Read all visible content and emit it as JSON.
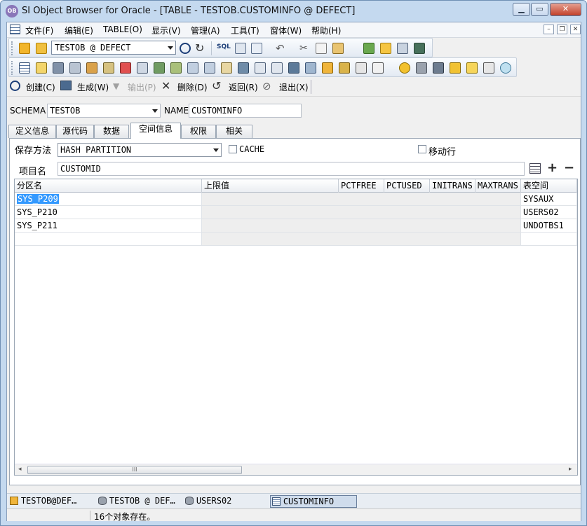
{
  "window": {
    "app_icon_text": "OB",
    "title": "SI Object Browser for Oracle - [TABLE - TESTOB.CUSTOMINFO @ DEFECT]"
  },
  "menu": [
    "文件(F)",
    "编辑(E)",
    "TABLE(O)",
    "显示(V)",
    "管理(A)",
    "工具(T)",
    "窗体(W)",
    "帮助(H)"
  ],
  "toolbar": {
    "connection": "TESTOB @ DEFECT",
    "sql_label": "SQL"
  },
  "actions": {
    "create": "创建(C)",
    "generate": "生成(W)",
    "output": "输出(P)",
    "delete": "删除(D)",
    "back": "返回(R)",
    "exit": "退出(X)"
  },
  "object": {
    "schema_label": "SCHEMA",
    "schema_value": "TESTOB",
    "name_label": "NAME",
    "name_value": "CUSTOMINFO"
  },
  "tabs": [
    "定义信息",
    "源代码",
    "数据",
    "空间信息",
    "权限",
    "相关"
  ],
  "active_tab": "空间信息",
  "space": {
    "storage_label": "保存方法",
    "storage_value": "HASH PARTITION",
    "cache_label": "CACHE",
    "row_movement_label": "移动行",
    "column_label": "项目名",
    "column_value": "CUSTOMID",
    "add_symbol": "+",
    "remove_symbol": "−"
  },
  "grid": {
    "columns": [
      "分区名",
      "上限值",
      "PCTFREE",
      "PCTUSED",
      "INITRANS",
      "MAXTRANS",
      "表空间"
    ],
    "rows": [
      {
        "partition": "SYS_P209",
        "tablespace": "SYSAUX"
      },
      {
        "partition": "SYS_P210",
        "tablespace": "USERS02"
      },
      {
        "partition": "SYS_P211",
        "tablespace": "UNDOTBS1"
      }
    ],
    "scroll_thumb_text": "III"
  },
  "window_tabs": [
    "TESTOB@DEF…",
    "TESTOB @ DEF…",
    "USERS02",
    "CUSTOMINFO"
  ],
  "status": {
    "message": "16个对象存在。"
  },
  "colors": {
    "frame": "#c4d9ef",
    "selection": "#3399ff",
    "read_only": "#eeeeee"
  }
}
